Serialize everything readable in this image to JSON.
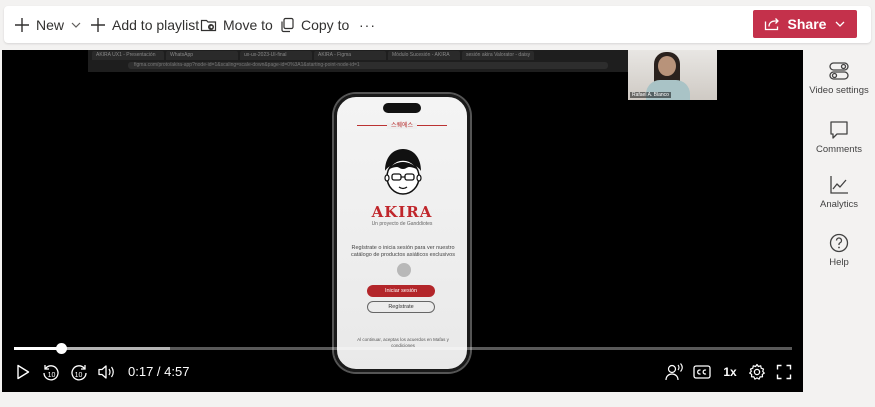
{
  "toolbar": {
    "new_label": "New",
    "add_to_playlist_label": "Add to playlist",
    "move_to_label": "Move to",
    "copy_to_label": "Copy to",
    "more_label": "···",
    "share_label": "Share",
    "share_color": "#c4314b"
  },
  "video": {
    "browser_tabs": [
      "AKIRA UX1 - Presentación",
      "WhatsApp",
      "ux-ux-2023-UI-final",
      "AKIRA - Figma",
      "Módulo Sucesión - AKIRA",
      "sesión akira Valorator - daisy"
    ],
    "browser_url": "figma.com/proto/akira-app?node-id=1&scaling=scale-down&page-id=0%3A1&starting-point-node-id=1",
    "webcam_caption": "Rafael A. Blanco",
    "app": {
      "korean_header": "스퀘에스",
      "brand": "AKIRA",
      "tagline": "Un proyecto de Ganddiotes",
      "description": "Regístrate o inicia sesión para ver nuestro catálogo de productos asiáticos exclusivos",
      "login_button": "Iniciar sesión",
      "register_button": "Regístrate",
      "footer_note": "Al continuar, aceptas los acuerdos en Mafas y condiciones"
    },
    "progress": {
      "played_fraction": 0.06,
      "buffered_fraction": 0.2
    },
    "time_display": "0:17 / 4:57",
    "skip_back_label": "10",
    "skip_forward_label": "10",
    "speed_label": "1x"
  },
  "rail": {
    "video_settings_label": "Video settings",
    "comments_label": "Comments",
    "analytics_label": "Analytics",
    "help_label": "Help"
  }
}
